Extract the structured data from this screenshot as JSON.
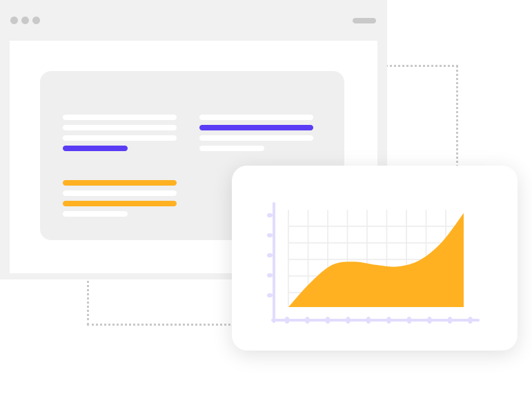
{
  "colors": {
    "window_bg": "#f1f1f1",
    "card_bg": "#efefef",
    "accent_purple": "#5b3cf5",
    "accent_orange": "#ffb121",
    "axis": "#e2dcff",
    "grid": "#ececec"
  },
  "browser": {
    "window_controls": [
      "dot",
      "dot",
      "dot"
    ],
    "menu_icon": "menu-pill-icon"
  },
  "chart_data": {
    "type": "area",
    "x": [
      0,
      1,
      2,
      3,
      4,
      5,
      6,
      7,
      8
    ],
    "values": [
      0,
      1.5,
      2.6,
      2.8,
      2.6,
      2.5,
      2.9,
      4.0,
      5.8
    ],
    "ylim": [
      0,
      6
    ],
    "grid": true,
    "title": "",
    "xlabel": "",
    "ylabel": ""
  }
}
